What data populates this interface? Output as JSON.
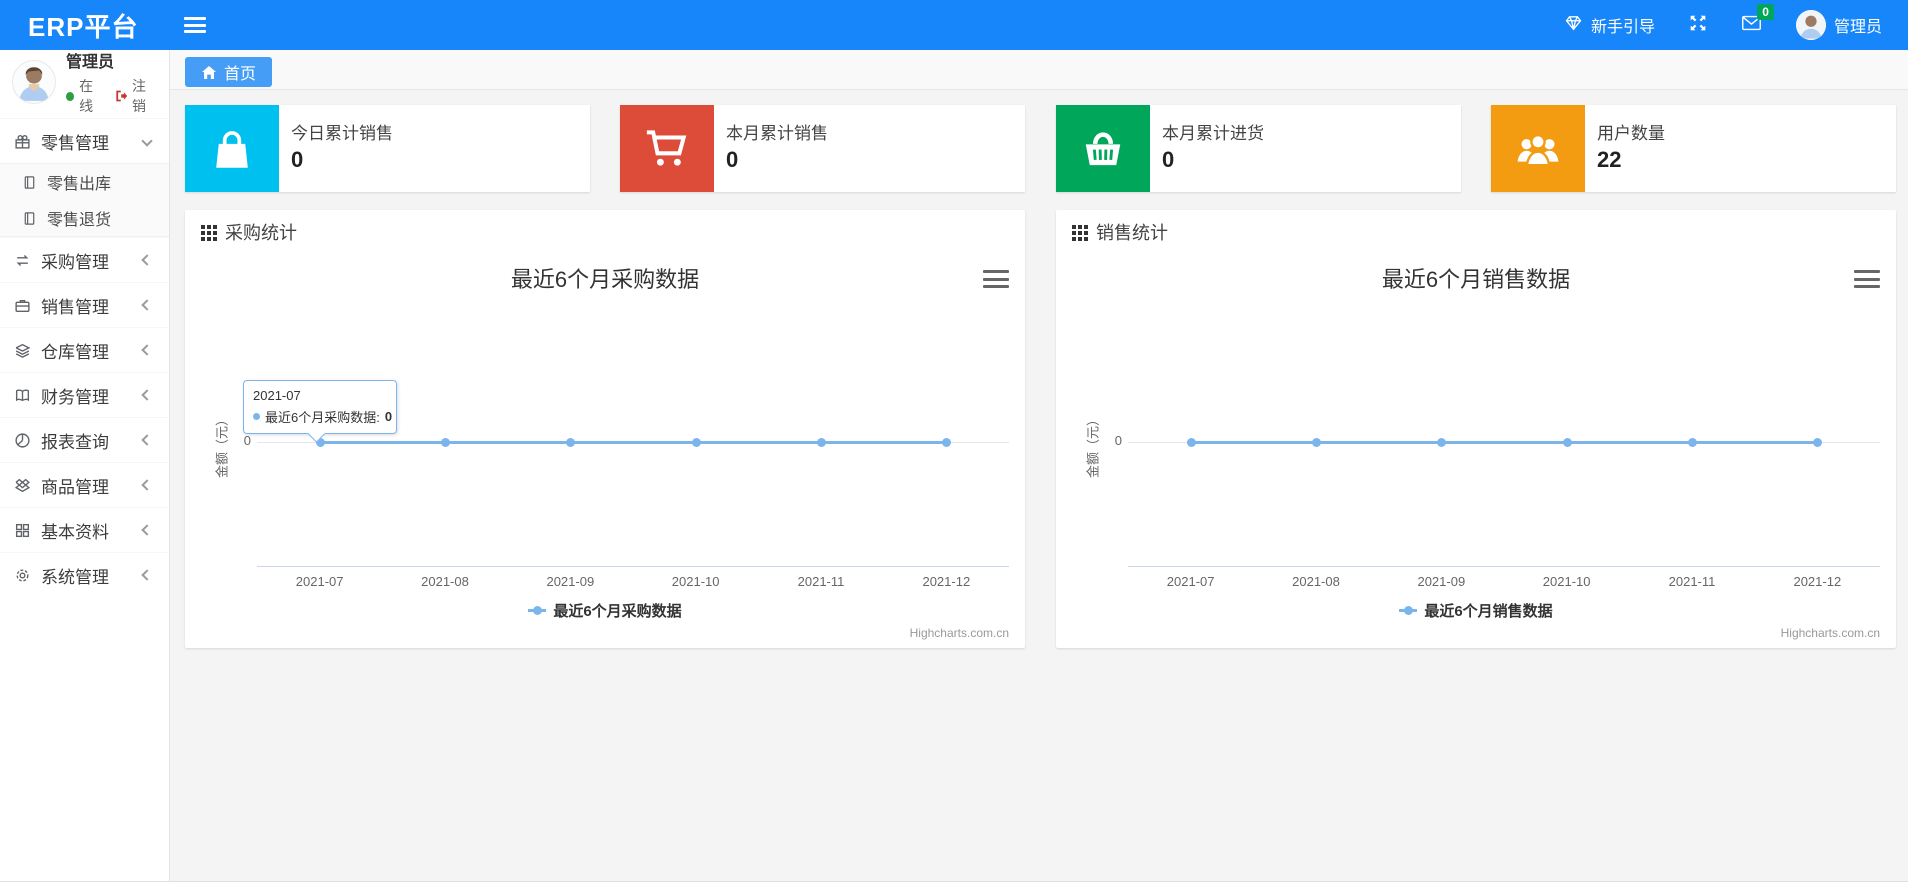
{
  "navbar": {
    "brand": "ERP平台",
    "guide": "新手引导",
    "badge": "0",
    "user": "管理员"
  },
  "sidebar": {
    "user_name": "管理员",
    "status": "在线",
    "logout": "注销",
    "items": [
      {
        "label": "零售管理",
        "icon": "gift-icon",
        "state": "expanded"
      },
      {
        "label": "零售出库",
        "icon": "file-icon"
      },
      {
        "label": "零售退货",
        "icon": "file-icon"
      },
      {
        "label": "采购管理",
        "icon": "exchange-icon"
      },
      {
        "label": "销售管理",
        "icon": "briefcase-icon"
      },
      {
        "label": "仓库管理",
        "icon": "layers-icon"
      },
      {
        "label": "财务管理",
        "icon": "book-icon"
      },
      {
        "label": "报表查询",
        "icon": "pie-chart-icon"
      },
      {
        "label": "商品管理",
        "icon": "cube-icon"
      },
      {
        "label": "基本资料",
        "icon": "grid-icon"
      },
      {
        "label": "系统管理",
        "icon": "gear-icon"
      }
    ]
  },
  "tabs": {
    "home": "首页"
  },
  "cards": [
    {
      "label": "今日累计销售",
      "value": "0",
      "color": "#00c0ef",
      "icon": "shopping-bag-icon"
    },
    {
      "label": "本月累计销售",
      "value": "0",
      "color": "#dd4b39",
      "icon": "cart-icon"
    },
    {
      "label": "本月累计进货",
      "value": "0",
      "color": "#00a65a",
      "icon": "basket-icon"
    },
    {
      "label": "用户数量",
      "value": "22",
      "color": "#f39c12",
      "icon": "users-icon"
    }
  ],
  "panels": [
    {
      "title": "采购统计"
    },
    {
      "title": "销售统计"
    }
  ],
  "theme": {
    "navbar_blue": "#1786fa",
    "tab_blue": "#459df5",
    "line_blue": "#7cb5ec",
    "badge_green": "#00a65a"
  },
  "chart_data": [
    {
      "type": "line",
      "title": "最近6个月采购数据",
      "ylabel": "金额（元）",
      "yticks": [
        "0"
      ],
      "categories": [
        "2021-07",
        "2021-08",
        "2021-09",
        "2021-10",
        "2021-11",
        "2021-12"
      ],
      "series": [
        {
          "name": "最近6个月采购数据",
          "values": [
            0,
            0,
            0,
            0,
            0,
            0
          ],
          "color": "#7cb5ec"
        }
      ],
      "ylim": [
        0,
        1
      ],
      "legend_position": "bottom",
      "credits": "Highcharts.com.cn",
      "tooltip": {
        "header": "2021-07",
        "label": "最近6个月采购数据:",
        "value": "0"
      }
    },
    {
      "type": "line",
      "title": "最近6个月销售数据",
      "ylabel": "金额（元）",
      "yticks": [
        "0"
      ],
      "categories": [
        "2021-07",
        "2021-08",
        "2021-09",
        "2021-10",
        "2021-11",
        "2021-12"
      ],
      "series": [
        {
          "name": "最近6个月销售数据",
          "values": [
            0,
            0,
            0,
            0,
            0,
            0
          ],
          "color": "#7cb5ec"
        }
      ],
      "ylim": [
        0,
        1
      ],
      "legend_position": "bottom",
      "credits": "Highcharts.com.cn"
    }
  ]
}
